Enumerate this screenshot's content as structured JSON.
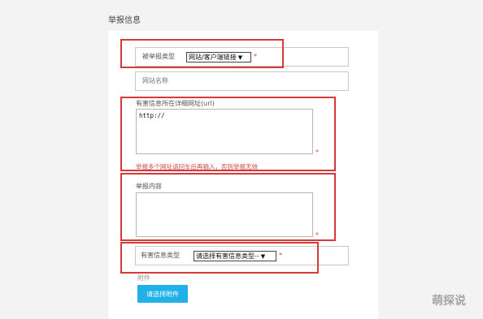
{
  "page": {
    "title": "举报信息"
  },
  "form": {
    "report_type": {
      "label": "被举报类型",
      "value": "网站/客户端链接",
      "required_mark": "*"
    },
    "site_name": {
      "placeholder": "网站名称"
    },
    "url": {
      "label": "有害信息所在详细网址(url)",
      "value": "http://",
      "required_mark": "*",
      "hint": "举报多个网址请回车后再输入，否则举报无效"
    },
    "content": {
      "label": "举报内容",
      "required_mark": "*"
    },
    "harm_type": {
      "label": "有害信息类型",
      "value": "请选择有害信息类型--",
      "required_mark": "*"
    },
    "attachment": {
      "label": "附件",
      "button_label": "请选择附件"
    }
  },
  "watermark": {
    "text": "萌探说"
  },
  "colors": {
    "highlight_border": "#d63a3a",
    "upload_button": "#1fb1e8",
    "required": "#e23b3b"
  }
}
